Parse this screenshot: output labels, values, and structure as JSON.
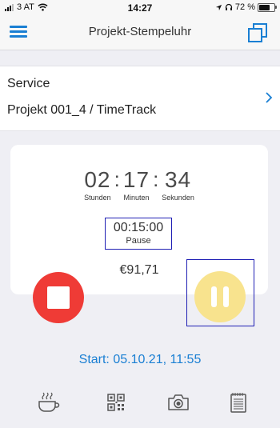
{
  "status_bar": {
    "carrier": "3 AT",
    "time": "14:27",
    "battery_percent": "72 %",
    "battery_level": 0.72
  },
  "nav": {
    "title": "Projekt-Stempeluhr",
    "menu_icon": "hamburger-menu-icon",
    "copy_icon": "copy-icon"
  },
  "project": {
    "service": "Service",
    "name": "Projekt 001_4 / TimeTrack"
  },
  "timer": {
    "hours": "02",
    "minutes": "17",
    "seconds": "34",
    "hours_label": "Stunden",
    "minutes_label": "Minuten",
    "seconds_label": "Sekunden",
    "separator": ":",
    "pause_time": "00:15:00",
    "pause_label": "Pause",
    "amount": "€91,71"
  },
  "start_text": "Start: 05.10.21, 11:55",
  "toolbar": [
    "coffee-cup-icon",
    "qr-code-icon",
    "camera-icon",
    "notepad-icon"
  ],
  "colors": {
    "accent": "#1a7fd3",
    "stop": "#ef3b36",
    "pause": "#f8e38e",
    "highlight_box": "#1f1fb4"
  }
}
